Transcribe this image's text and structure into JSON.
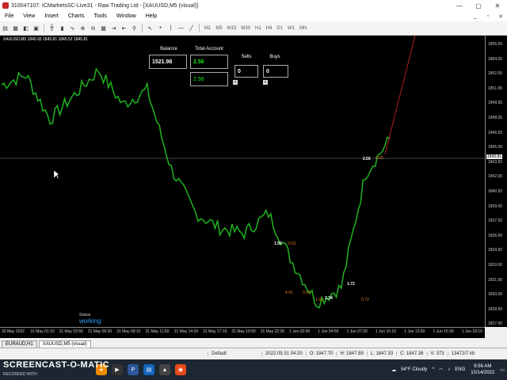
{
  "window": {
    "title": "310047107: ICMarketsSC-Live31 - Raw Trading Ltd - [XAUUSD,M5 (visual)]",
    "minimize": "—",
    "restore": "▢",
    "close": "✕"
  },
  "menu": {
    "items": [
      "File",
      "View",
      "Insert",
      "Charts",
      "Tools",
      "Window",
      "Help"
    ],
    "mdi_minimize": "_",
    "mdi_restore": "▫",
    "mdi_close": "✕"
  },
  "toolbar": {
    "timeframes": [
      "M1",
      "M5",
      "M15",
      "M30",
      "H1",
      "H4",
      "D1",
      "W1",
      "MN"
    ],
    "icons": [
      "new-chart-icon",
      "profiles-icon",
      "zoom-in-icon",
      "zoom-out-icon",
      "grid-icon",
      "auto-scroll-icon",
      "chart-shift-icon",
      "indicators-icon",
      "crosshair-icon",
      "line-icon"
    ]
  },
  "chart": {
    "symbol_info": "XAUUSD,M5  1845.65 1845.81 1845.52 1845.81",
    "current_price": "1845.81",
    "price_ticks": [
      "1855.55",
      "1854.05",
      "1852.55",
      "1851.05",
      "1849.55",
      "1848.05",
      "1846.55",
      "1845.00",
      "1843.50",
      "1842.00",
      "1840.50",
      "1839.00",
      "1837.50",
      "1836.00",
      "1834.50",
      "1833.00",
      "1831.50",
      "1830.00",
      "1828.50",
      "1827.00"
    ],
    "time_ticks": [
      "30 May 2022",
      "31 May 01:10",
      "31 May 03:50",
      "31 May 06:30",
      "31 May 09:10",
      "31 May 11:50",
      "31 May 14:30",
      "31 May 17:10",
      "31 May 19:50",
      "31 May 22:30",
      "1 Jun 02:00",
      "1 Jun 04:50",
      "1 Jun 07:30",
      "1 Jun 10:10",
      "1 Jun 12:50",
      "1 Jun 15:30",
      "1 Jun 18:10"
    ],
    "colors": {
      "background": "#000000",
      "candles": "#1faa1f",
      "trend_line": "#b02020",
      "status": "#2aa3ff",
      "profit_label": "#e07a20"
    },
    "chart_data": {
      "type": "line",
      "x": [
        "30 May 2022",
        "31 May 01:10",
        "31 May 03:50",
        "31 May 06:30",
        "31 May 09:10",
        "31 May 11:50",
        "31 May 14:30",
        "31 May 17:10",
        "31 May 19:50",
        "31 May 22:30",
        "1 Jun 02:00",
        "1 Jun 04:50",
        "1 Jun 07:30",
        "1 Jun 10:10",
        "1 Jun 12:50",
        "1 Jun 15:30",
        "1 Jun 18:10"
      ],
      "series": [
        {
          "values": [
            1851.5,
            1852.5,
            1848.0,
            1850.5,
            1853.0,
            1849.5,
            1851.0,
            1843.0,
            1838.5,
            1837.0,
            1836.5,
            1838.5,
            1833.5,
            1829.5,
            1831.0,
            1842.5,
            1846.0
          ]
        }
      ],
      "ylim": [
        1827.0,
        1856.5
      ]
    }
  },
  "panel": {
    "balance_label": "Balance",
    "balance_value": "1521.98",
    "total_account_label": "Total Account",
    "total_account_value": "2.56",
    "total_account_value2": "2.56",
    "sells_label": "Sells",
    "sells_value": "0",
    "buys_label": "Buys",
    "buys_value": "0",
    "close_btn": "x",
    "status_label": "Status",
    "status_value": "working"
  },
  "markers": {
    "m1": "0.61",
    "m2": "1.50",
    "m3": "4.41",
    "m4": "0.00",
    "m5": "2.34",
    "m6": "1.09",
    "m7": "1.72",
    "m8": "0.72",
    "m9": "2.56",
    "m10": "0.65"
  },
  "tabs": [
    "EURAUD,H1",
    "XAUUSD,M5 (visual)"
  ],
  "status_bar": {
    "profile": "Default",
    "datetime": "2022.05.31 04:20",
    "open": "O: 1847.70",
    "high": "H: 1847.89",
    "low": "L: 1847.33",
    "close": "C: 1847.38",
    "volume": "V: 373",
    "traffic": "13472/7 kb"
  },
  "taskbar": {
    "watermark": "SCREENCAST-O-MATIC",
    "watermark_sub": "RECORDED WITH",
    "weather": "54°F  Cloudy",
    "lang": "ENG",
    "time": "6:56 AM",
    "date": "10/14/2022"
  }
}
